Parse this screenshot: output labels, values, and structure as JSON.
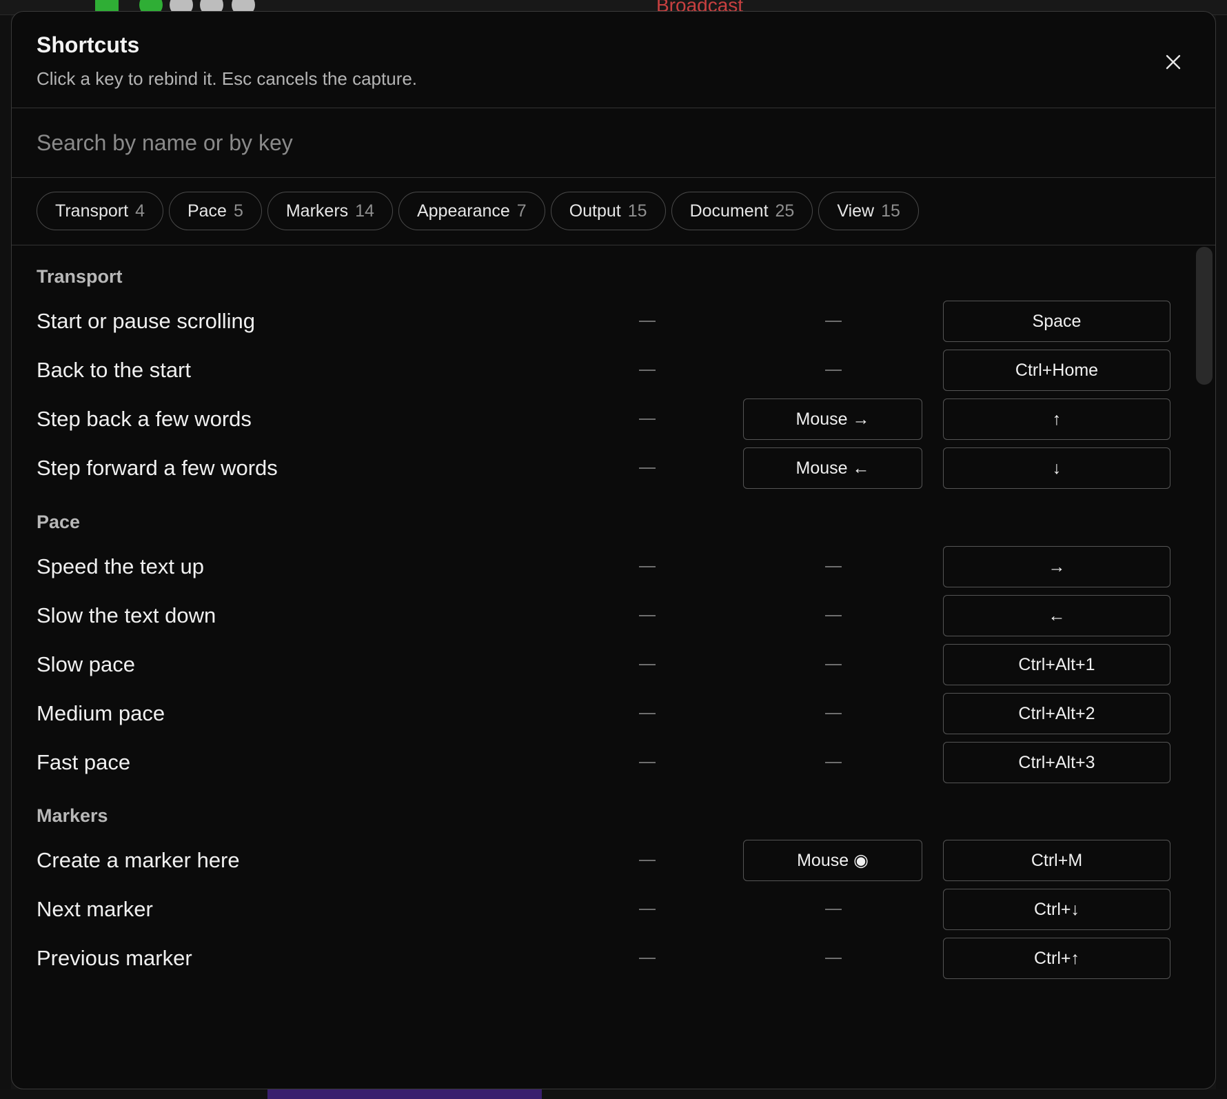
{
  "background": {
    "broadcast_label": "Broadcast"
  },
  "dialog": {
    "title": "Shortcuts",
    "subtitle": "Click a key to rebind it. Esc cancels the capture.",
    "search_placeholder": "Search by name or by key",
    "chips": [
      {
        "label": "Transport",
        "count": "4"
      },
      {
        "label": "Pace",
        "count": "5"
      },
      {
        "label": "Markers",
        "count": "14"
      },
      {
        "label": "Appearance",
        "count": "7"
      },
      {
        "label": "Output",
        "count": "15"
      },
      {
        "label": "Document",
        "count": "25"
      },
      {
        "label": "View",
        "count": "15"
      }
    ]
  },
  "sections": [
    {
      "title": "Transport",
      "rows": [
        {
          "label": "Start or pause scrolling",
          "col2": "",
          "col3": "Space"
        },
        {
          "label": "Back to the start",
          "col2": "",
          "col3": "Ctrl+Home"
        },
        {
          "label": "Step back a few words",
          "col2": "Mouse →",
          "col3": "↑"
        },
        {
          "label": "Step forward a few words",
          "col2": "Mouse ←",
          "col3": "↓"
        }
      ]
    },
    {
      "title": "Pace",
      "rows": [
        {
          "label": "Speed the text up",
          "col2": "",
          "col3": "→"
        },
        {
          "label": "Slow the text down",
          "col2": "",
          "col3": "←"
        },
        {
          "label": "Slow pace",
          "col2": "",
          "col3": "Ctrl+Alt+1"
        },
        {
          "label": "Medium pace",
          "col2": "",
          "col3": "Ctrl+Alt+2"
        },
        {
          "label": "Fast pace",
          "col2": "",
          "col3": "Ctrl+Alt+3"
        }
      ]
    },
    {
      "title": "Markers",
      "rows": [
        {
          "label": "Create a marker here",
          "col2": "Mouse ◉",
          "col3": "Ctrl+M"
        },
        {
          "label": "Next marker",
          "col2": "",
          "col3": "Ctrl+↓"
        },
        {
          "label": "Previous marker",
          "col2": "",
          "col3": "Ctrl+↑"
        }
      ]
    }
  ]
}
